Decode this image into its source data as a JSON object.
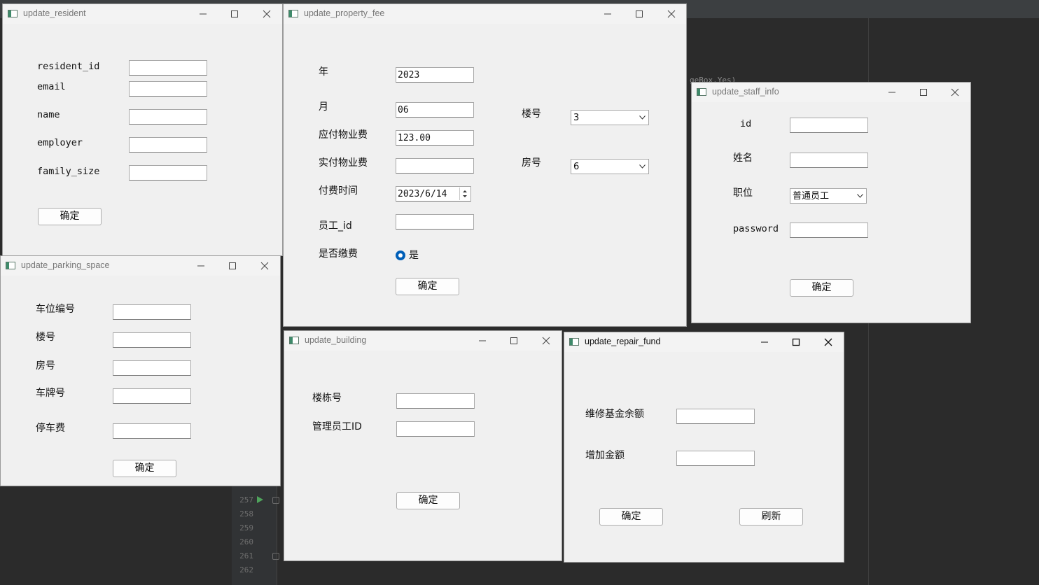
{
  "ide": {
    "line_numbers": [
      "257",
      "258",
      "259",
      "260",
      "261",
      "262"
    ],
    "code_fragment": "geBox.Yes)"
  },
  "windows": {
    "resident": {
      "title": "update_resident",
      "labels": [
        "resident_id",
        "email",
        "name",
        "employer",
        "family_size"
      ],
      "values": [
        "",
        "",
        "",
        "",
        ""
      ],
      "ok_label": "确定"
    },
    "property_fee": {
      "title": "update_property_fee",
      "labels": {
        "year": "年",
        "month": "月",
        "due": "应付物业费",
        "paid": "实付物业费",
        "pay_time": "付费时间",
        "staff_id": "员工_id",
        "is_paid": "是否缴费",
        "building": "楼号",
        "room": "房号"
      },
      "values": {
        "year": "2023",
        "month": "06",
        "due": "123.00",
        "paid": "",
        "pay_time": "2023/6/14",
        "staff_id": "",
        "building": "3",
        "room": "6"
      },
      "radio_label": "是",
      "ok_label": "确定"
    },
    "staff_info": {
      "title": "update_staff_info",
      "labels": {
        "id": "id",
        "name": "姓名",
        "position": "职位",
        "password": "password"
      },
      "values": {
        "id": "",
        "name": "",
        "position": "普通员工",
        "password": ""
      },
      "ok_label": "确定"
    },
    "parking_space": {
      "title": "update_parking_space",
      "labels": [
        "车位编号",
        "楼号",
        "房号",
        "车牌号",
        "停车费"
      ],
      "values": [
        "",
        "",
        "",
        "",
        ""
      ],
      "ok_label": "确定"
    },
    "building": {
      "title": "update_building",
      "labels": [
        "楼栋号",
        "管理员工ID"
      ],
      "values": [
        "",
        ""
      ],
      "ok_label": "确定"
    },
    "repair_fund": {
      "title": "update_repair_fund",
      "labels": [
        "维修基金余额",
        "增加金额"
      ],
      "values": [
        "",
        ""
      ],
      "ok_label": "确定",
      "refresh_label": "刷新"
    }
  }
}
